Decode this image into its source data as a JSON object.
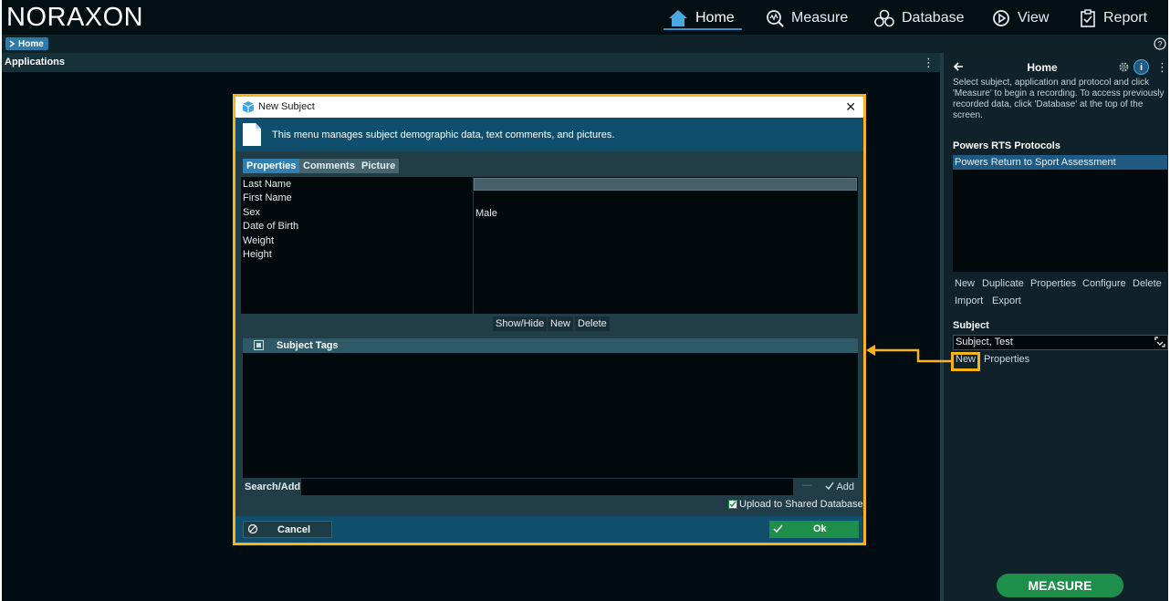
{
  "app": {
    "logo": "NORAXON",
    "nav": [
      {
        "label": "Home",
        "icon": "home-icon",
        "active": true
      },
      {
        "label": "Measure",
        "icon": "measure-icon",
        "active": false
      },
      {
        "label": "Database",
        "icon": "database-icon",
        "active": false
      },
      {
        "label": "View",
        "icon": "view-icon",
        "active": false
      },
      {
        "label": "Report",
        "icon": "report-icon",
        "active": false
      }
    ],
    "breadcrumb": "Home",
    "accent_color": "#3b8fc7"
  },
  "applications": {
    "title": "Applications"
  },
  "right_panel": {
    "title": "Home",
    "description": "Select subject, application and protocol and click 'Measure' to begin a recording. To access previously recorded data, click 'Database' at the top of the screen.",
    "protocols_title": "Powers RTS Protocols",
    "protocols": [
      "Powers Return to Sport Assessment"
    ],
    "protocol_actions": [
      "New",
      "Duplicate",
      "Properties",
      "Configure",
      "Delete",
      "Import",
      "Export"
    ],
    "subject_title": "Subject",
    "subject_value": "Subject, Test",
    "subject_actions": [
      "New",
      "Properties"
    ],
    "measure_label": "MEASURE",
    "measure_color": "#1e8f4a"
  },
  "dialog": {
    "title": "New Subject",
    "header_text": "This menu manages subject demographic data, text comments, and pictures.",
    "tabs": [
      "Properties",
      "Comments",
      "Picture"
    ],
    "active_tab": "Properties",
    "fields": [
      "Last Name",
      "First Name",
      "Sex",
      "Date of Birth",
      "Weight",
      "Height"
    ],
    "sex_value": "Male",
    "table_actions": [
      "Show/Hide",
      "New",
      "Delete"
    ],
    "tags_title": "Subject Tags",
    "search_label": "Search/Add",
    "search_dash": "—",
    "add_label": "Add",
    "upload_label": "Upload to Shared Database",
    "upload_checked": true,
    "cancel_label": "Cancel",
    "ok_label": "Ok",
    "highlight_color": "#f8b21a"
  }
}
